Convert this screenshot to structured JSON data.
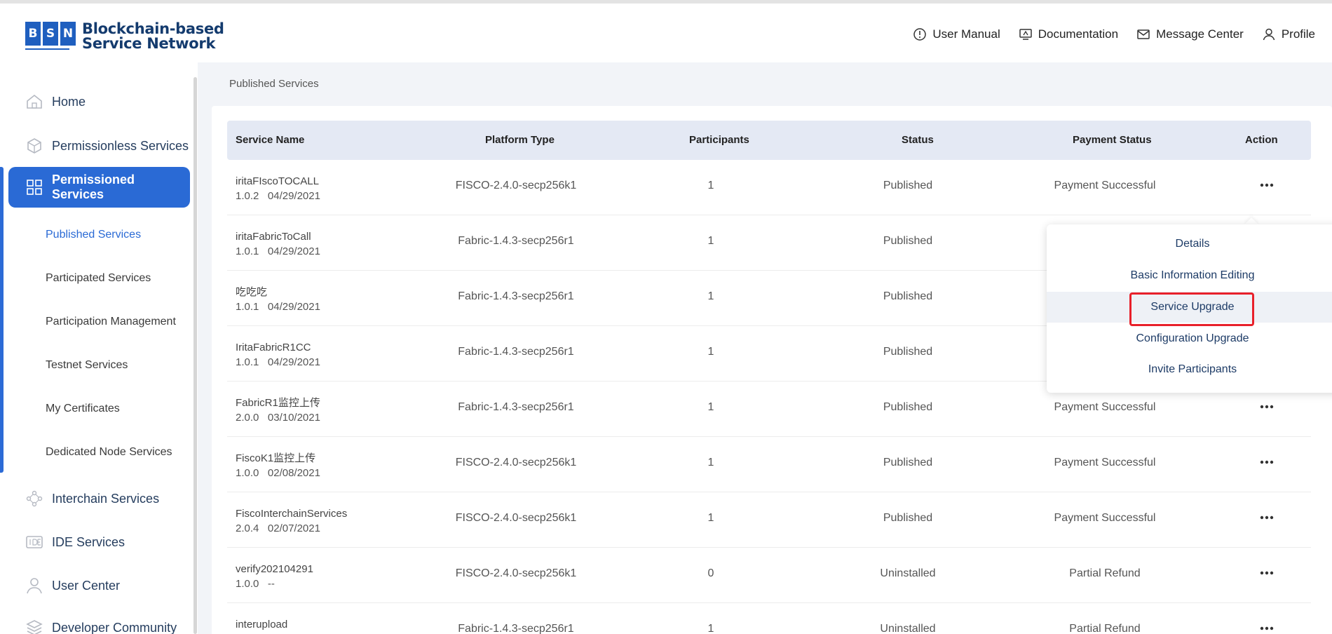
{
  "logo": {
    "letters": [
      "B",
      "S",
      "N"
    ],
    "line1": "Blockchain-based",
    "line2": "Service Network"
  },
  "header_nav": [
    {
      "label": "User Manual",
      "icon": "question-circle-icon"
    },
    {
      "label": "Documentation",
      "icon": "monitor-icon"
    },
    {
      "label": "Message Center",
      "icon": "mail-icon"
    },
    {
      "label": "Profile",
      "icon": "user-icon"
    }
  ],
  "sidebar": {
    "items": [
      {
        "label": "Home",
        "icon": "home-icon"
      },
      {
        "label": "Permissionless Services",
        "icon": "box-icon"
      },
      {
        "label": "Permissioned Services",
        "icon": "grid-icon",
        "active": true
      },
      {
        "label": "Interchain Services",
        "icon": "network-icon"
      },
      {
        "label": "IDE Services",
        "icon": "ide-icon"
      },
      {
        "label": "User Center",
        "icon": "user-icon"
      },
      {
        "label": "Developer Community",
        "icon": "layers-icon"
      }
    ],
    "subitems": [
      {
        "label": "Published Services",
        "active": true
      },
      {
        "label": "Participated Services"
      },
      {
        "label": "Participation Management"
      },
      {
        "label": "Testnet Services"
      },
      {
        "label": "My Certificates"
      },
      {
        "label": "Dedicated Node Services"
      }
    ]
  },
  "breadcrumb": "Published Services",
  "table": {
    "headers": [
      "Service Name",
      "Platform Type",
      "Participants",
      "Status",
      "Payment Status",
      "Action"
    ],
    "rows": [
      {
        "name": "iritaFIscoTOCALL",
        "version": "1.0.2",
        "date": "04/29/2021",
        "platform": "FISCO-2.4.0-secp256k1",
        "participants": "1",
        "status": "Published",
        "payment": "Payment Successful"
      },
      {
        "name": "iritaFabricToCall",
        "version": "1.0.1",
        "date": "04/29/2021",
        "platform": "Fabric-1.4.3-secp256r1",
        "participants": "1",
        "status": "Published",
        "payment": ""
      },
      {
        "name": "吃吃吃",
        "version": "1.0.1",
        "date": "04/29/2021",
        "platform": "Fabric-1.4.3-secp256r1",
        "participants": "1",
        "status": "Published",
        "payment": ""
      },
      {
        "name": "IritaFabricR1CC",
        "version": "1.0.1",
        "date": "04/29/2021",
        "platform": "Fabric-1.4.3-secp256r1",
        "participants": "1",
        "status": "Published",
        "payment": ""
      },
      {
        "name": "FabricR1监控上传",
        "version": "2.0.0",
        "date": "03/10/2021",
        "platform": "Fabric-1.4.3-secp256r1",
        "participants": "1",
        "status": "Published",
        "payment": "Payment Successful"
      },
      {
        "name": "FiscoK1监控上传",
        "version": "1.0.0",
        "date": "02/08/2021",
        "platform": "FISCO-2.4.0-secp256k1",
        "participants": "1",
        "status": "Published",
        "payment": "Payment Successful"
      },
      {
        "name": "FiscoInterchainServices",
        "version": "2.0.4",
        "date": "02/07/2021",
        "platform": "FISCO-2.4.0-secp256k1",
        "participants": "1",
        "status": "Published",
        "payment": "Payment Successful"
      },
      {
        "name": "verify202104291",
        "version": "1.0.0",
        "date": "--",
        "platform": "FISCO-2.4.0-secp256k1",
        "participants": "0",
        "status": "Uninstalled",
        "payment": "Partial Refund"
      },
      {
        "name": "interupload",
        "version": "",
        "date": "",
        "platform": "Fabric-1.4.3-secp256r1",
        "participants": "1",
        "status": "Uninstalled",
        "payment": "Partial Refund"
      }
    ]
  },
  "dropdown": {
    "items": [
      "Details",
      "Basic Information Editing",
      "Service Upgrade",
      "Configuration Upgrade",
      "Invite Participants"
    ],
    "hovered": "Service Upgrade"
  },
  "colors": {
    "brand": "#2a6ad5",
    "highlight": "#e8202a"
  }
}
